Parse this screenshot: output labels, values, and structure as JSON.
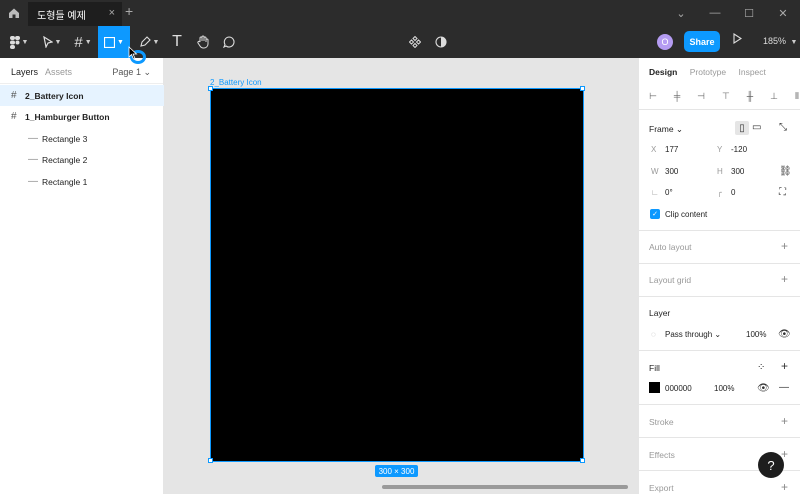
{
  "tabbar": {
    "doc_title": "도형들 예제",
    "close": "×",
    "new_tab": "+"
  },
  "window_controls": [
    "⌄",
    "—",
    "☐",
    "✕"
  ],
  "toolbar": {
    "tools": [
      "main-menu",
      "move",
      "frame",
      "rectangle",
      "pen",
      "text",
      "hand",
      "comment"
    ],
    "share_label": "Share",
    "avatar_initial": "O",
    "zoom": "185%",
    "accent": "#0d99ff"
  },
  "layers_panel": {
    "tab_layers": "Layers",
    "tab_assets": "Assets",
    "page": "Page 1",
    "items": [
      {
        "name": "2_Battery Icon",
        "type": "frame"
      },
      {
        "name": "1_Hamburger Button",
        "type": "frame"
      },
      {
        "name": "Rectangle 3",
        "type": "rect"
      },
      {
        "name": "Rectangle 2",
        "type": "rect"
      },
      {
        "name": "Rectangle 1",
        "type": "rect"
      }
    ]
  },
  "canvas": {
    "frame_label": "2_Battery Icon",
    "size_badge": "300 × 300",
    "frame_fill": "#000000"
  },
  "design_panel": {
    "tabs": [
      "Design",
      "Prototype",
      "Inspect"
    ],
    "frame_title": "Frame",
    "x_label": "X",
    "x": "177",
    "y_label": "Y",
    "y": "-120",
    "w_label": "W",
    "w": "300",
    "h_label": "H",
    "h": "300",
    "rotation": "0°",
    "radius": "0",
    "clip_content": "Clip content",
    "auto_layout": "Auto layout",
    "layout_grid": "Layout grid",
    "layer_title": "Layer",
    "blend": "Pass through",
    "layer_opacity": "100%",
    "fill_title": "Fill",
    "fill_hex": "000000",
    "fill_opacity": "100%",
    "stroke": "Stroke",
    "effects": "Effects",
    "export": "Export"
  }
}
